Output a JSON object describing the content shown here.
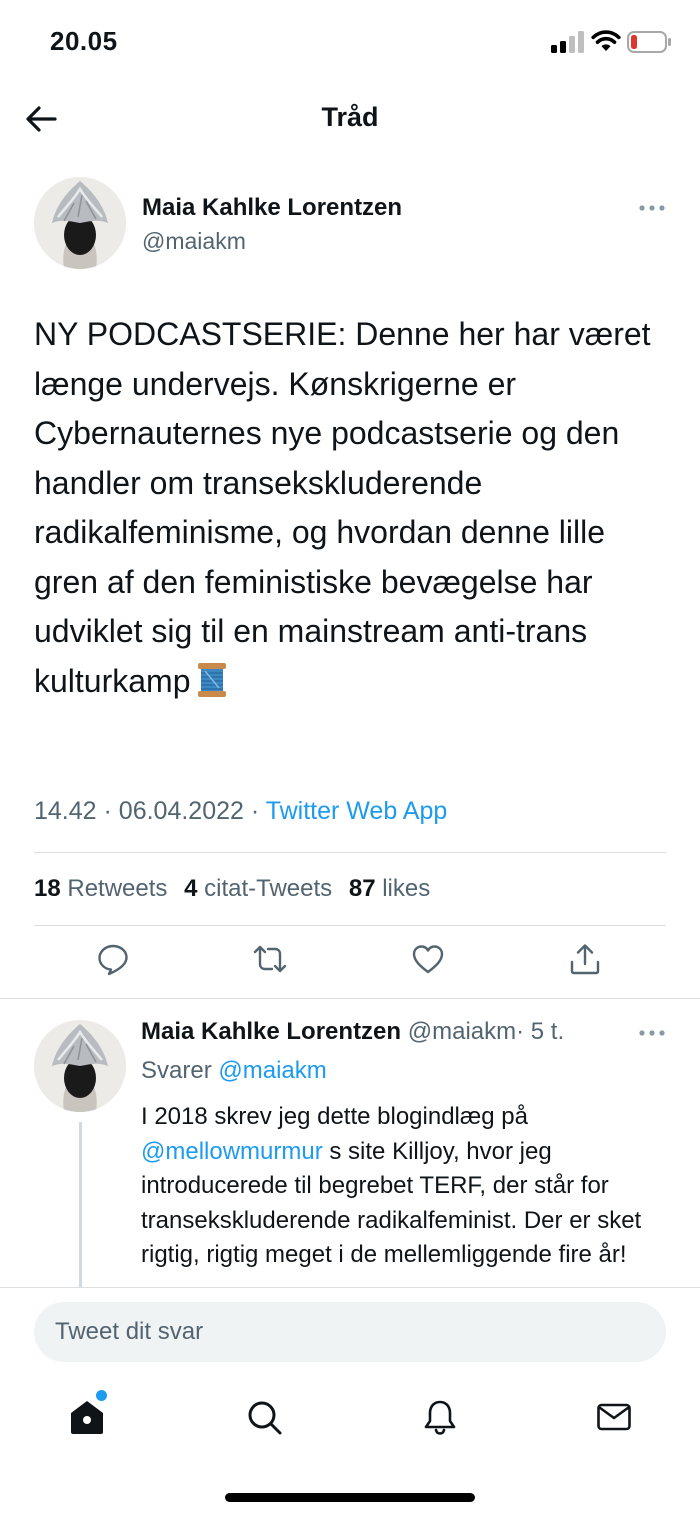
{
  "status_bar": {
    "time": "20.05"
  },
  "nav": {
    "title": "Tråd"
  },
  "main_tweet": {
    "author_name": "Maia Kahlke Lorentzen",
    "author_handle": "@maiakm",
    "text": "NY PODCASTSERIE: Denne her har været længe undervejs. Kønskrigerne er Cybernauternes nye podcastserie og den handler om transekskluderende radikalfeminisme, og hvordan denne lille gren af den feministiske bevægelse har udviklet sig til en mainstream anti-trans kulturkamp",
    "time": "14.42",
    "date": "06.04.2022",
    "separator": "·",
    "source": "Twitter Web App",
    "retweets_count": "18",
    "retweets_label": "Retweets",
    "quotes_count": "4",
    "quotes_label": "citat-Tweets",
    "likes_count": "87",
    "likes_label": "likes"
  },
  "reply": {
    "author_name": "Maia Kahlke Lorentzen",
    "author_handle": "@maiakm",
    "age": "· 5 t.",
    "replying_to_label": "Svarer",
    "replying_to_handle": "@maiakm",
    "text_part1": "I 2018 skrev jeg dette blogindlæg på ",
    "mention": "@mellowmurmur",
    "text_part2": " s site Killjoy, hvor jeg introducerede til begrebet TERF, der står for transekskluderende radikalfeminist. Der er sket rigtig, rigtig meget i de mellemliggende fire år!"
  },
  "compose": {
    "placeholder": "Tweet dit svar"
  },
  "icons": {
    "back": "arrow-left-icon",
    "more": "more-horizontal-icon",
    "reply": "reply-icon",
    "retweet": "retweet-icon",
    "like": "heart-icon",
    "share": "share-icon",
    "home": "home-icon",
    "search": "search-icon",
    "notifications": "bell-icon",
    "messages": "mail-icon"
  },
  "colors": {
    "accent": "#1d9bf0",
    "secondary_text": "#536471",
    "battery_low": "#e0352b"
  }
}
